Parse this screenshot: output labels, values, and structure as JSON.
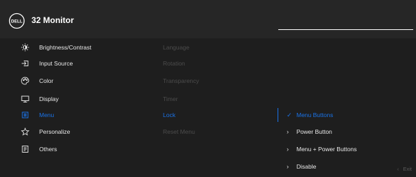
{
  "header": {
    "logo_text": "DELL",
    "title": "32 Monitor"
  },
  "menu": [
    {
      "label": "Brightness/Contrast",
      "icon": "brightness-icon"
    },
    {
      "label": "Input Source",
      "icon": "input-source-icon"
    },
    {
      "label": "Color",
      "icon": "palette-icon"
    },
    {
      "label": "Display",
      "icon": "display-icon"
    },
    {
      "label": "Menu",
      "icon": "menu-icon"
    },
    {
      "label": "Personalize",
      "icon": "star-icon"
    },
    {
      "label": "Others",
      "icon": "others-icon"
    }
  ],
  "submenu": [
    "Language",
    "Rotation",
    "Transparency",
    "Timer",
    "Lock",
    "Reset Menu"
  ],
  "options": [
    {
      "mark": "✓",
      "label": "Menu Buttons"
    },
    {
      "mark": "›",
      "label": "Power Button"
    },
    {
      "mark": "›",
      "label": "Menu + Power Buttons"
    },
    {
      "mark": "›",
      "label": "Disable"
    }
  ],
  "footer": {
    "exit_chevron": "‹",
    "exit_label": "Exit"
  },
  "colors": {
    "accent": "#1a73e8",
    "background": "#1e1e1e",
    "header": "#262626",
    "disabled_text": "#4c4c4c"
  }
}
